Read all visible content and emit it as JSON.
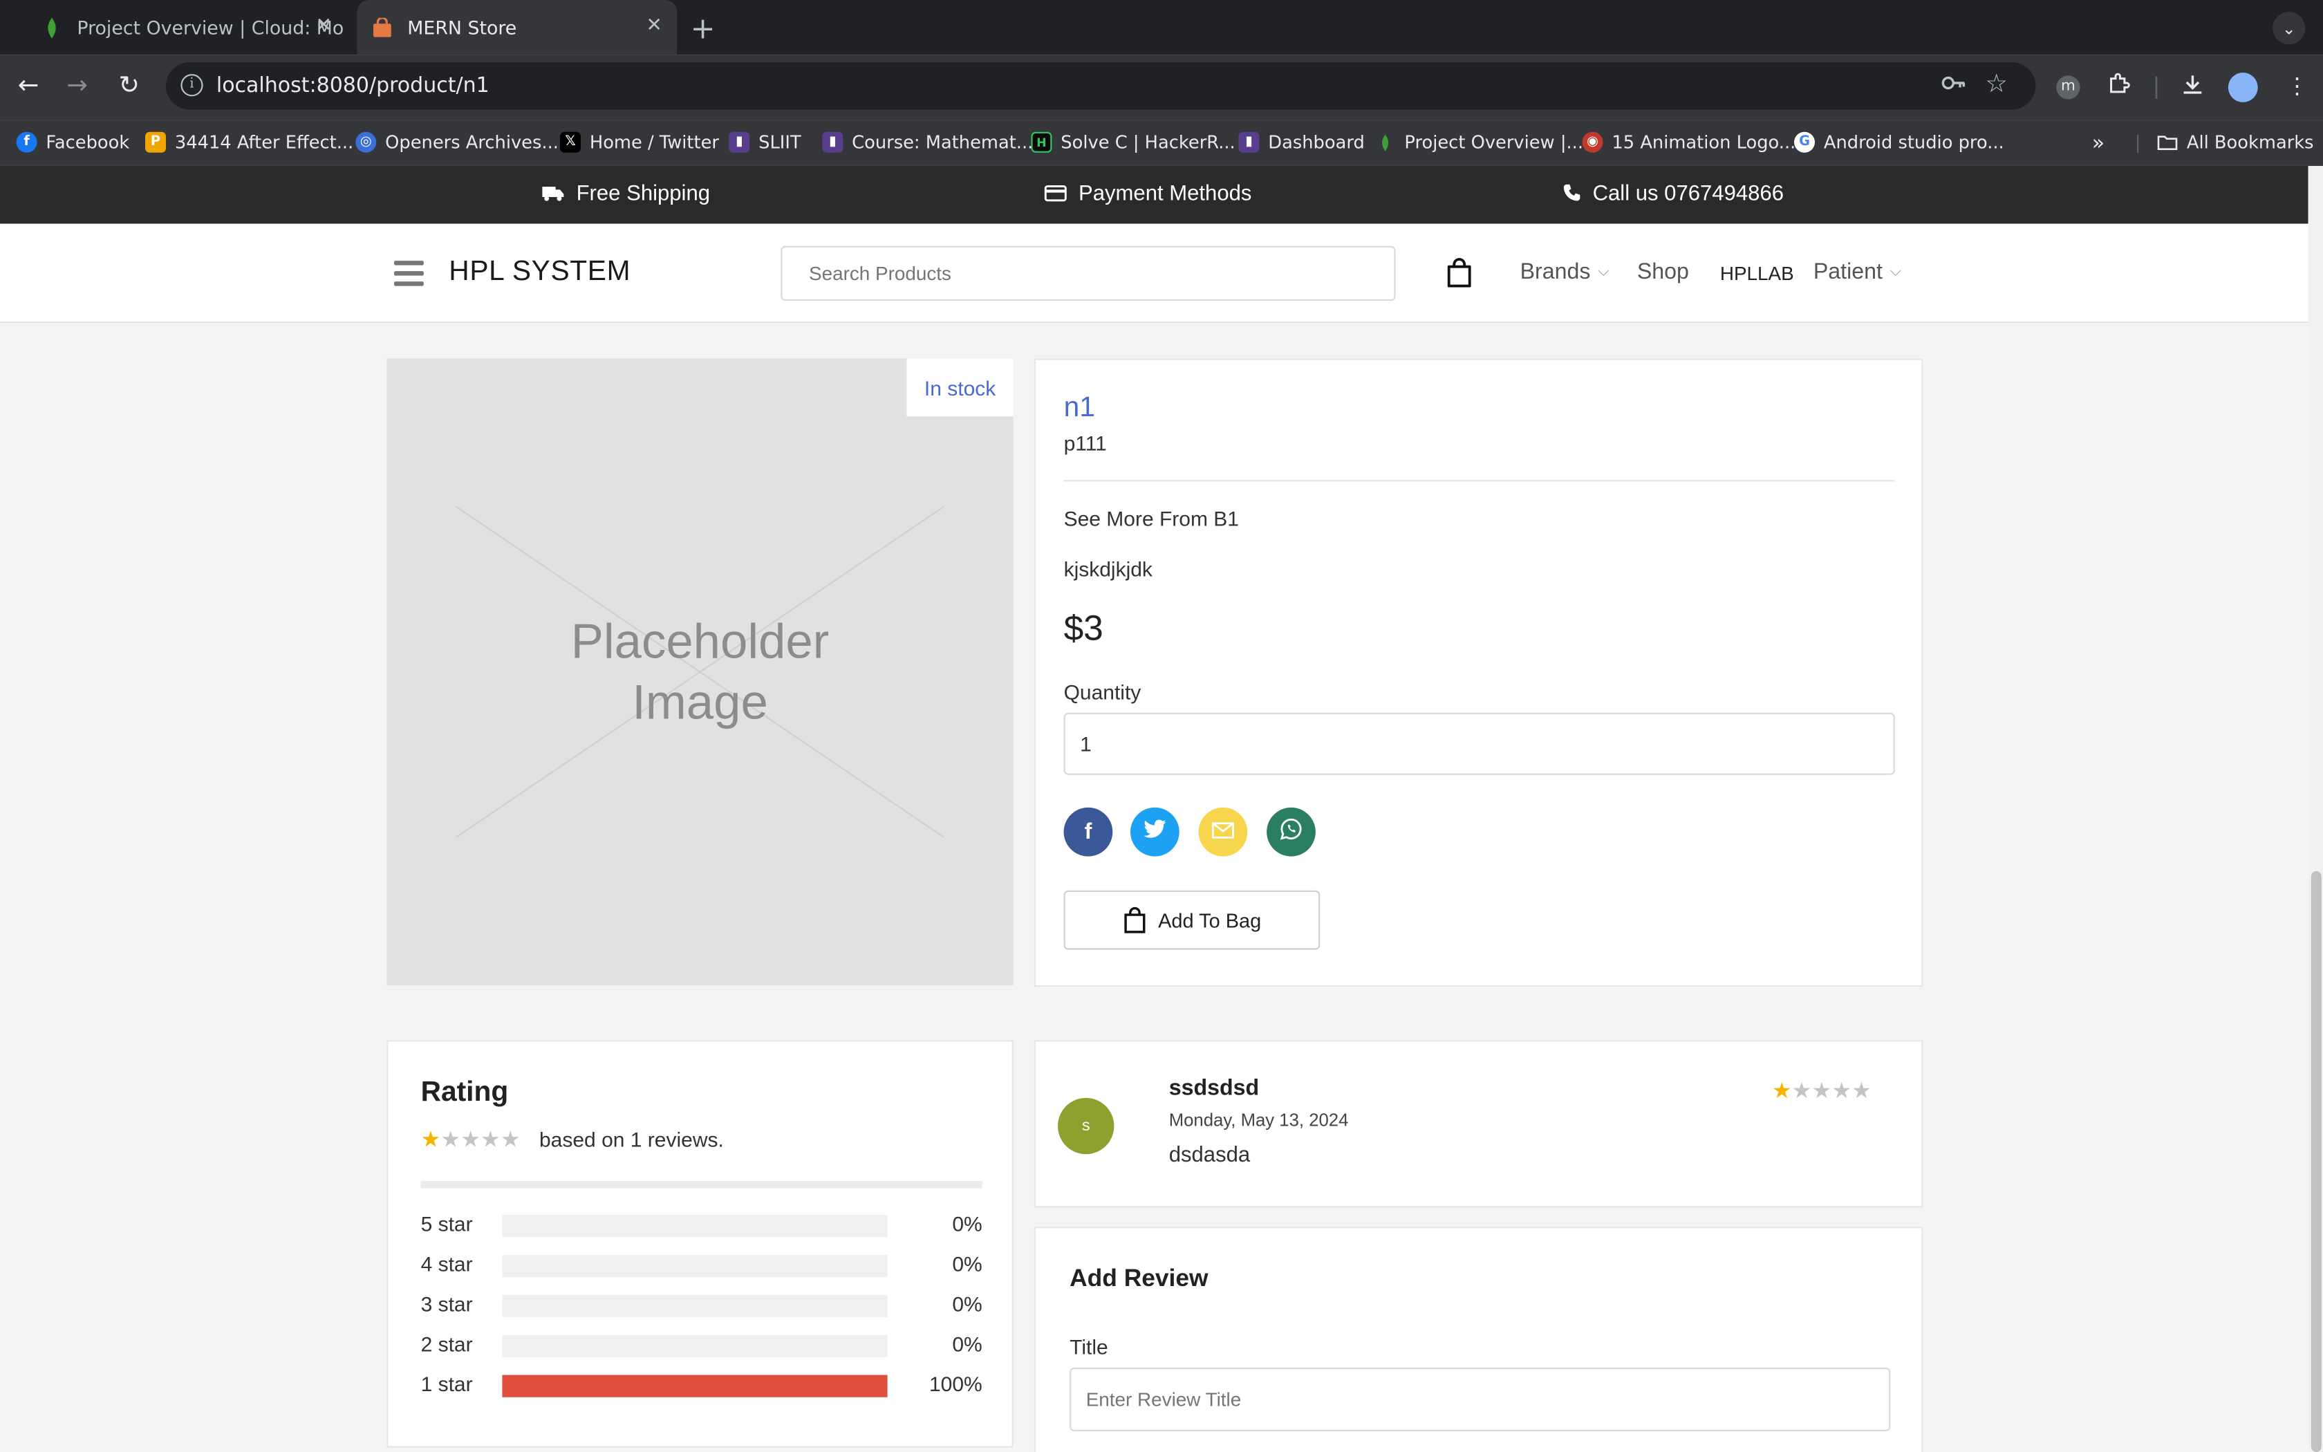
{
  "browser": {
    "tabs": [
      {
        "title": "Project Overview | Cloud: Mo"
      },
      {
        "title": "MERN Store"
      }
    ],
    "url": "localhost:8080/product/n1",
    "bookmarks": [
      {
        "label": "Facebook",
        "icon": "facebook-icon"
      },
      {
        "label": "34414 After Effect...",
        "icon": "p-icon"
      },
      {
        "label": "Openers Archives...",
        "icon": "openers-icon"
      },
      {
        "label": "Home / Twitter",
        "icon": "x-icon"
      },
      {
        "label": "SLIIT",
        "icon": "sliit-icon"
      },
      {
        "label": "Course: Mathemat...",
        "icon": "course-icon"
      },
      {
        "label": "Solve C | HackerR...",
        "icon": "hackerrank-icon"
      },
      {
        "label": "Dashboard",
        "icon": "dashboard-icon"
      },
      {
        "label": "Project Overview |...",
        "icon": "mongodb-icon"
      },
      {
        "label": "15 Animation Logo...",
        "icon": "animation-icon"
      },
      {
        "label": "Android studio pro...",
        "icon": "google-icon"
      }
    ],
    "all_bookmarks": "All Bookmarks"
  },
  "topbar": {
    "shipping": "Free Shipping",
    "payment": "Payment Methods",
    "call": "Call us 0767494866"
  },
  "header": {
    "brand": "HPL SYSTEM",
    "search_placeholder": "Search Products",
    "nav": {
      "brands": "Brands",
      "shop": "Shop",
      "hpllab": "HPLLAB",
      "patient": "Patient"
    }
  },
  "product": {
    "image_text": "Placeholder Image",
    "stock": "In stock",
    "name": "n1",
    "sku": "p111",
    "see_more": "See More From B1",
    "description": "kjskdjkjdk",
    "price": "$3",
    "quantity_label": "Quantity",
    "quantity": "1",
    "add_to_bag": "Add To Bag"
  },
  "rating": {
    "title": "Rating",
    "average": 1,
    "based_on": "based on 1 reviews.",
    "rows": [
      {
        "label": "5 star",
        "percent_text": "0%",
        "percent": 0
      },
      {
        "label": "4 star",
        "percent_text": "0%",
        "percent": 0
      },
      {
        "label": "3 star",
        "percent_text": "0%",
        "percent": 0
      },
      {
        "label": "2 star",
        "percent_text": "0%",
        "percent": 0
      },
      {
        "label": "1 star",
        "percent_text": "100%",
        "percent": 100
      }
    ]
  },
  "review": {
    "avatar_letter": "s",
    "name": "ssdsdsd",
    "date": "Monday, May 13, 2024",
    "body": "dsdasda",
    "stars": 1
  },
  "add_review": {
    "title": "Add Review",
    "title_label": "Title",
    "title_placeholder": "Enter Review Title"
  },
  "colors": {
    "accent_blue": "#4a68d9",
    "star": "#f4b400",
    "bar_fill": "#e04e3c",
    "topbar": "#2a2a2a",
    "facebook": "#3b5998",
    "twitter": "#1da1f2",
    "email": "#f7d54c",
    "whatsapp": "#2a7f62"
  }
}
